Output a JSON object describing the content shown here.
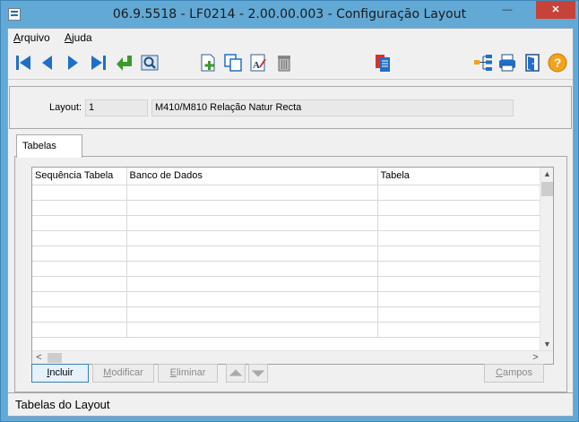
{
  "window": {
    "title": "06.9.5518 - LF0214 - 2.00.00.003 - Configuração Layout",
    "minimize": "—",
    "maximize": "□",
    "close": "✕"
  },
  "menu": {
    "items": [
      {
        "label": "Arquivo",
        "accel": "A"
      },
      {
        "label": "Ajuda",
        "accel": "A"
      }
    ]
  },
  "toolbar": {
    "icons": [
      "first-record-icon",
      "previous-record-icon",
      "next-record-icon",
      "last-record-icon",
      "return-icon",
      "preview-icon",
      "new-document-icon",
      "copy-icon",
      "edit-text-icon",
      "trash-icon",
      "report-icon",
      "hierarchy-icon",
      "printer-icon",
      "exit-door-icon",
      "help-icon"
    ],
    "help_glyph": "?"
  },
  "header": {
    "layout_label": "Layout:",
    "layout_code": "1",
    "layout_description": "M410/M810 Relação Natur Recta"
  },
  "tabs": [
    {
      "label": "Tabelas",
      "active": true
    }
  ],
  "grid": {
    "columns": [
      "Sequência Tabela",
      "Banco de Dados",
      "Tabela"
    ],
    "row_count": 10,
    "scroll_up": "▲",
    "scroll_down": "▼",
    "scroll_left": "<",
    "scroll_right": ">"
  },
  "buttons": {
    "incluir": "Incluir",
    "incluir_accel": "I",
    "modificar": "Modificar",
    "modificar_accel": "M",
    "eliminar": "Eliminar",
    "eliminar_accel": "E",
    "campos": "Campos",
    "campos_accel": "C"
  },
  "status": {
    "text": "Tabelas do Layout"
  },
  "colors": {
    "window_frame": "#63a9d6",
    "close_button": "#c7433a",
    "toolbar_blue": "#1f6fc8",
    "green_arrow": "#3a9a2a",
    "help_orange": "#f2a21b"
  }
}
